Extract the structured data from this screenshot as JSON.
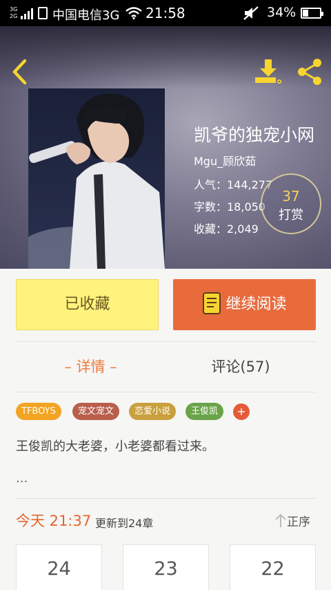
{
  "status_bar": {
    "net_top": "3G",
    "net_bottom": "2G",
    "carrier": "中国电信3G",
    "time": "21:58",
    "battery": "34%",
    "battery_level": 0.34
  },
  "book": {
    "title": "凯爷的独宠小网",
    "author": "Mgu_顾欣茹",
    "popularity": "人气：144,277",
    "words": "字数：18,050",
    "favorites": "收藏：2,049",
    "tip_count": "37",
    "tip_label": "打赏"
  },
  "actions": {
    "collected": "已收藏",
    "continue": "继续阅读"
  },
  "tabs": {
    "detail": "– 详情 –",
    "comments": "评论(57)"
  },
  "tags": [
    {
      "label": "TFBOYS",
      "color": "#f2a422"
    },
    {
      "label": "宠文宠文",
      "color": "#b85f4c"
    },
    {
      "label": "恋爱小说",
      "color": "#c9a03d"
    },
    {
      "label": "王俊凯",
      "color": "#6aa44a"
    }
  ],
  "tag_add": "+",
  "description": "王俊凯的大老婆，小老婆都看过来。",
  "ellipsis": "...",
  "update": {
    "time": "今天 21:37",
    "text": "更新到24章",
    "sort": "正序"
  },
  "chapters": [
    "24",
    "23",
    "22"
  ],
  "colors": {
    "accent": "#e96b3c",
    "yellow": "#fff37e",
    "icon_yellow": "#f7d430"
  },
  "icons": {
    "back": "chevron-left-icon",
    "download": "download-icon",
    "share": "share-icon",
    "book": "book-icon",
    "sort": "arrow-up-icon"
  }
}
